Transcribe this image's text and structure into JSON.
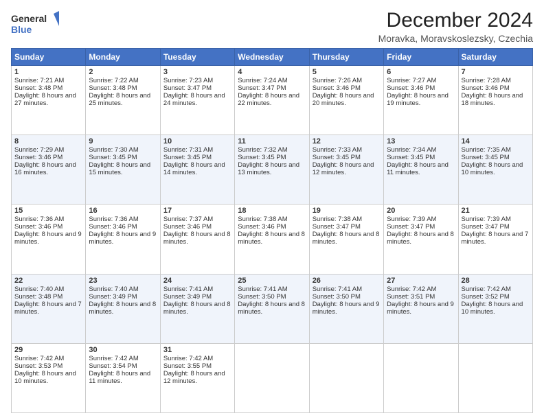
{
  "logo": {
    "line1": "General",
    "line2": "Blue"
  },
  "title": "December 2024",
  "subtitle": "Moravka, Moravskoslezsky, Czechia",
  "weekdays": [
    "Sunday",
    "Monday",
    "Tuesday",
    "Wednesday",
    "Thursday",
    "Friday",
    "Saturday"
  ],
  "weeks": [
    [
      {
        "day": "1",
        "sunrise": "Sunrise: 7:21 AM",
        "sunset": "Sunset: 3:48 PM",
        "daylight": "Daylight: 8 hours and 27 minutes."
      },
      {
        "day": "2",
        "sunrise": "Sunrise: 7:22 AM",
        "sunset": "Sunset: 3:48 PM",
        "daylight": "Daylight: 8 hours and 25 minutes."
      },
      {
        "day": "3",
        "sunrise": "Sunrise: 7:23 AM",
        "sunset": "Sunset: 3:47 PM",
        "daylight": "Daylight: 8 hours and 24 minutes."
      },
      {
        "day": "4",
        "sunrise": "Sunrise: 7:24 AM",
        "sunset": "Sunset: 3:47 PM",
        "daylight": "Daylight: 8 hours and 22 minutes."
      },
      {
        "day": "5",
        "sunrise": "Sunrise: 7:26 AM",
        "sunset": "Sunset: 3:46 PM",
        "daylight": "Daylight: 8 hours and 20 minutes."
      },
      {
        "day": "6",
        "sunrise": "Sunrise: 7:27 AM",
        "sunset": "Sunset: 3:46 PM",
        "daylight": "Daylight: 8 hours and 19 minutes."
      },
      {
        "day": "7",
        "sunrise": "Sunrise: 7:28 AM",
        "sunset": "Sunset: 3:46 PM",
        "daylight": "Daylight: 8 hours and 18 minutes."
      }
    ],
    [
      {
        "day": "8",
        "sunrise": "Sunrise: 7:29 AM",
        "sunset": "Sunset: 3:46 PM",
        "daylight": "Daylight: 8 hours and 16 minutes."
      },
      {
        "day": "9",
        "sunrise": "Sunrise: 7:30 AM",
        "sunset": "Sunset: 3:45 PM",
        "daylight": "Daylight: 8 hours and 15 minutes."
      },
      {
        "day": "10",
        "sunrise": "Sunrise: 7:31 AM",
        "sunset": "Sunset: 3:45 PM",
        "daylight": "Daylight: 8 hours and 14 minutes."
      },
      {
        "day": "11",
        "sunrise": "Sunrise: 7:32 AM",
        "sunset": "Sunset: 3:45 PM",
        "daylight": "Daylight: 8 hours and 13 minutes."
      },
      {
        "day": "12",
        "sunrise": "Sunrise: 7:33 AM",
        "sunset": "Sunset: 3:45 PM",
        "daylight": "Daylight: 8 hours and 12 minutes."
      },
      {
        "day": "13",
        "sunrise": "Sunrise: 7:34 AM",
        "sunset": "Sunset: 3:45 PM",
        "daylight": "Daylight: 8 hours and 11 minutes."
      },
      {
        "day": "14",
        "sunrise": "Sunrise: 7:35 AM",
        "sunset": "Sunset: 3:45 PM",
        "daylight": "Daylight: 8 hours and 10 minutes."
      }
    ],
    [
      {
        "day": "15",
        "sunrise": "Sunrise: 7:36 AM",
        "sunset": "Sunset: 3:46 PM",
        "daylight": "Daylight: 8 hours and 9 minutes."
      },
      {
        "day": "16",
        "sunrise": "Sunrise: 7:36 AM",
        "sunset": "Sunset: 3:46 PM",
        "daylight": "Daylight: 8 hours and 9 minutes."
      },
      {
        "day": "17",
        "sunrise": "Sunrise: 7:37 AM",
        "sunset": "Sunset: 3:46 PM",
        "daylight": "Daylight: 8 hours and 8 minutes."
      },
      {
        "day": "18",
        "sunrise": "Sunrise: 7:38 AM",
        "sunset": "Sunset: 3:46 PM",
        "daylight": "Daylight: 8 hours and 8 minutes."
      },
      {
        "day": "19",
        "sunrise": "Sunrise: 7:38 AM",
        "sunset": "Sunset: 3:47 PM",
        "daylight": "Daylight: 8 hours and 8 minutes."
      },
      {
        "day": "20",
        "sunrise": "Sunrise: 7:39 AM",
        "sunset": "Sunset: 3:47 PM",
        "daylight": "Daylight: 8 hours and 8 minutes."
      },
      {
        "day": "21",
        "sunrise": "Sunrise: 7:39 AM",
        "sunset": "Sunset: 3:47 PM",
        "daylight": "Daylight: 8 hours and 7 minutes."
      }
    ],
    [
      {
        "day": "22",
        "sunrise": "Sunrise: 7:40 AM",
        "sunset": "Sunset: 3:48 PM",
        "daylight": "Daylight: 8 hours and 7 minutes."
      },
      {
        "day": "23",
        "sunrise": "Sunrise: 7:40 AM",
        "sunset": "Sunset: 3:49 PM",
        "daylight": "Daylight: 8 hours and 8 minutes."
      },
      {
        "day": "24",
        "sunrise": "Sunrise: 7:41 AM",
        "sunset": "Sunset: 3:49 PM",
        "daylight": "Daylight: 8 hours and 8 minutes."
      },
      {
        "day": "25",
        "sunrise": "Sunrise: 7:41 AM",
        "sunset": "Sunset: 3:50 PM",
        "daylight": "Daylight: 8 hours and 8 minutes."
      },
      {
        "day": "26",
        "sunrise": "Sunrise: 7:41 AM",
        "sunset": "Sunset: 3:50 PM",
        "daylight": "Daylight: 8 hours and 9 minutes."
      },
      {
        "day": "27",
        "sunrise": "Sunrise: 7:42 AM",
        "sunset": "Sunset: 3:51 PM",
        "daylight": "Daylight: 8 hours and 9 minutes."
      },
      {
        "day": "28",
        "sunrise": "Sunrise: 7:42 AM",
        "sunset": "Sunset: 3:52 PM",
        "daylight": "Daylight: 8 hours and 10 minutes."
      }
    ],
    [
      {
        "day": "29",
        "sunrise": "Sunrise: 7:42 AM",
        "sunset": "Sunset: 3:53 PM",
        "daylight": "Daylight: 8 hours and 10 minutes."
      },
      {
        "day": "30",
        "sunrise": "Sunrise: 7:42 AM",
        "sunset": "Sunset: 3:54 PM",
        "daylight": "Daylight: 8 hours and 11 minutes."
      },
      {
        "day": "31",
        "sunrise": "Sunrise: 7:42 AM",
        "sunset": "Sunset: 3:55 PM",
        "daylight": "Daylight: 8 hours and 12 minutes."
      },
      null,
      null,
      null,
      null
    ]
  ]
}
